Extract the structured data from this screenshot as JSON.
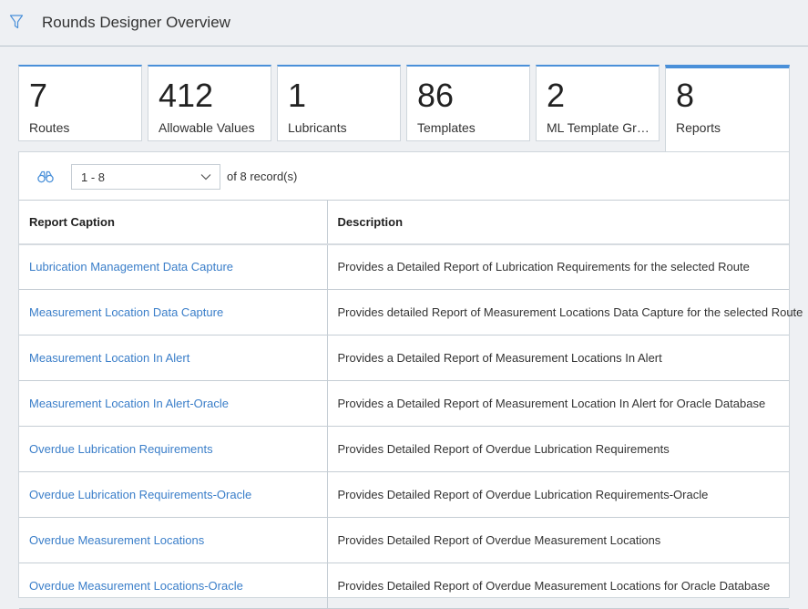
{
  "header": {
    "title": "Rounds Designer Overview",
    "filter_icon": "filter-icon"
  },
  "tiles": [
    {
      "count": "7",
      "label": "Routes",
      "active": false
    },
    {
      "count": "412",
      "label": "Allowable Values",
      "active": false
    },
    {
      "count": "1",
      "label": "Lubricants",
      "active": false
    },
    {
      "count": "86",
      "label": "Templates",
      "active": false
    },
    {
      "count": "2",
      "label": "ML Template Grou...",
      "active": false
    },
    {
      "count": "8",
      "label": "Reports",
      "active": true
    }
  ],
  "toolbar": {
    "range_value": "1 - 8",
    "of_label": "of",
    "total": "8",
    "records_label": "record(s)",
    "search_icon": "binoculars-icon"
  },
  "table": {
    "columns": [
      "Report Caption",
      "Description"
    ],
    "rows": [
      {
        "caption": "Lubrication Management Data Capture",
        "description": "Provides a Detailed Report of Lubrication Requirements for the selected Route"
      },
      {
        "caption": "Measurement Location Data Capture",
        "description": "Provides detailed Report of Measurement Locations Data Capture for the selected Route"
      },
      {
        "caption": "Measurement Location In Alert",
        "description": "Provides a Detailed Report of Measurement Locations In Alert"
      },
      {
        "caption": "Measurement Location In Alert-Oracle",
        "description": "Provides a Detailed Report of Measurement Location In Alert for Oracle Database"
      },
      {
        "caption": "Overdue Lubrication Requirements",
        "description": "Provides Detailed Report of Overdue Lubrication Requirements"
      },
      {
        "caption": "Overdue Lubrication Requirements-Oracle",
        "description": "Provides Detailed Report of Overdue Lubrication Requirements-Oracle"
      },
      {
        "caption": "Overdue Measurement Locations",
        "description": "Provides Detailed Report of Overdue Measurement Locations"
      },
      {
        "caption": "Overdue Measurement Locations-Oracle",
        "description": "Provides Detailed Report of Overdue Measurement Locations for Oracle Database"
      }
    ]
  },
  "colors": {
    "accent": "#4a90d9",
    "link": "#3a7ec9",
    "background": "#eef0f3"
  }
}
